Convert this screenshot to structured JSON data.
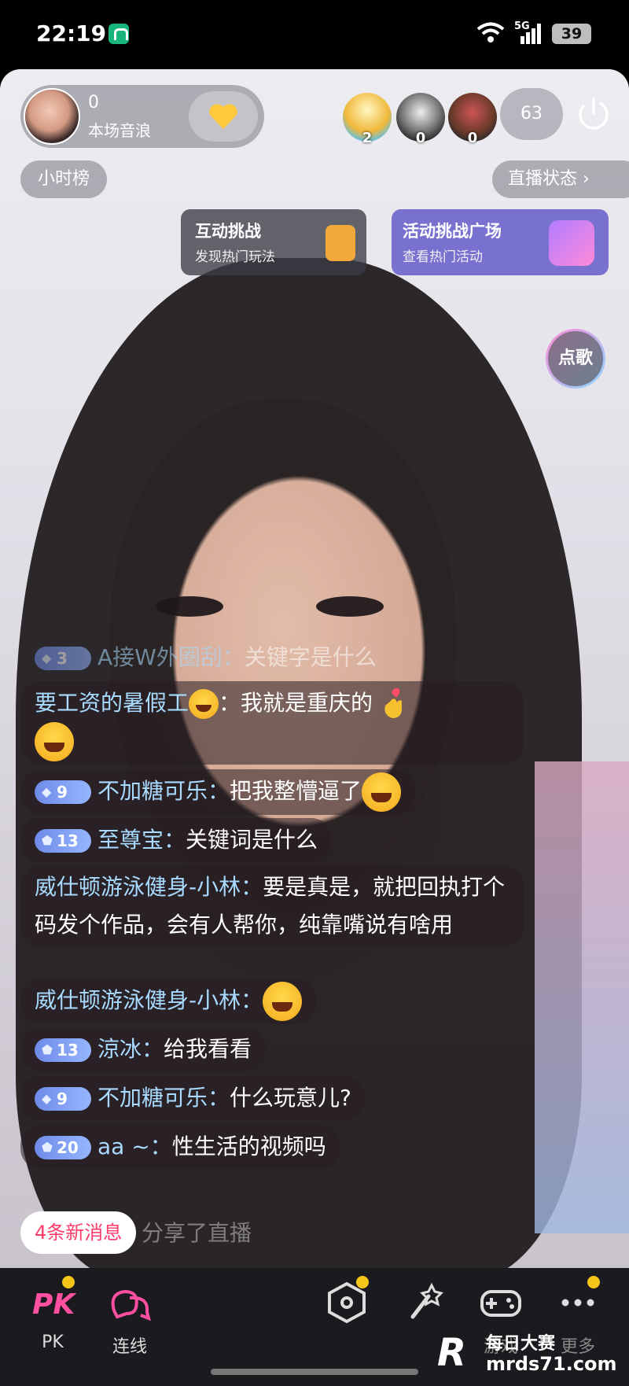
{
  "status_bar": {
    "time": "22:19",
    "network": "5G",
    "battery": "39"
  },
  "host": {
    "sound_wave_count": "0",
    "sound_wave_label": "本场音浪"
  },
  "viewers": {
    "top": [
      {
        "value": "2"
      },
      {
        "value": "0"
      },
      {
        "value": "0"
      }
    ],
    "total": "63"
  },
  "hour_rank_label": "小时榜",
  "live_status_label": "直播状态 ›",
  "challenge": {
    "title": "互动挑战",
    "subtitle": "发现热门玩法"
  },
  "activity": {
    "title": "活动挑战广场",
    "subtitle": "查看热门活动"
  },
  "song_request_label": "点歌",
  "chat": {
    "messages": [
      {
        "badge": "3",
        "user": "A接W外圈刮：",
        "text": "关键字是什么"
      },
      {
        "user": "要工资的暑假工",
        "text": "：我就是重庆的"
      },
      {
        "badge": "9",
        "user": "不加糖可乐：",
        "text": "把我整懵逼了"
      },
      {
        "badge": "13",
        "user": "至尊宝：",
        "text": "关键词是什么"
      },
      {
        "user": "威仕顿游泳健身-小林：",
        "text": "要是真是，就把回执打个码发个作品，会有人帮你，纯靠嘴说有啥用"
      },
      {
        "user": "威仕顿游泳健身-小林：",
        "text": ""
      },
      {
        "badge": "13",
        "user": "涼冰：",
        "text": "给我看看"
      },
      {
        "badge": "9",
        "user": "不加糖可乐：",
        "text": "什么玩意儿?"
      },
      {
        "badge": "20",
        "user": "aa ~：",
        "text": "性生活的视频吗"
      }
    ],
    "new_messages_label": "4条新消息",
    "shared_text": "分享了直播"
  },
  "toolbar": {
    "pk_label": "PK",
    "connect_label": "连线",
    "games_label": "游戏",
    "more_label": "更多"
  },
  "watermark": {
    "logo": "R",
    "title": "每日大赛",
    "url": "mrds71.com"
  },
  "colors": {
    "username": "#a8dbff",
    "badge": "#7d9af0",
    "notification_dot": "#f5c518",
    "new_messages_text": "#ff3b6a"
  }
}
